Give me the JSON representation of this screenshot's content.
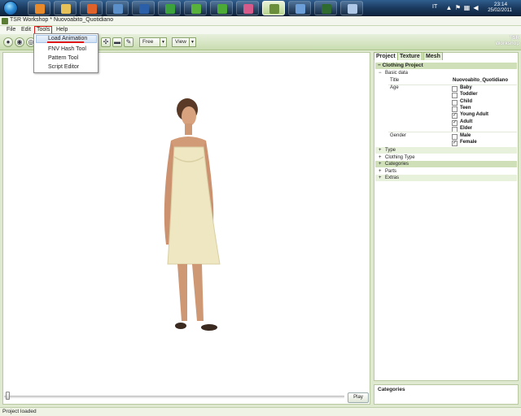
{
  "taskbar": {
    "language": "IT",
    "time": "23:14",
    "date": "25/02/2011",
    "apps": [
      {
        "icon": "media-player-icon",
        "color": "#e8892a"
      },
      {
        "icon": "folder-icon",
        "color": "#e6c15a"
      },
      {
        "icon": "firefox-icon",
        "color": "#e0622a"
      },
      {
        "icon": "globe-icon",
        "color": "#5b8fc9"
      },
      {
        "icon": "photoshop-icon",
        "color": "#2b5fa8"
      },
      {
        "icon": "green-app-icon",
        "color": "#3ca23c"
      },
      {
        "icon": "green-app-icon",
        "color": "#58b13a"
      },
      {
        "icon": "green-app-icon",
        "color": "#4caa36"
      },
      {
        "icon": "pink-app-icon",
        "color": "#d65b8a"
      },
      {
        "icon": "tsr-workshop-icon",
        "color": "#6b8e3d"
      },
      {
        "icon": "globe-icon",
        "color": "#6c9fd8"
      },
      {
        "icon": "w-app-icon",
        "color": "#2f6b2f"
      },
      {
        "icon": "paint-icon",
        "color": "#b0c8e8"
      }
    ]
  },
  "window": {
    "title": "TSR Workshop * Nuovoabito_Quotidiano"
  },
  "menubar": {
    "file": "File",
    "edit": "Edit",
    "tools": "Tools",
    "help": "Help"
  },
  "tools_menu": {
    "items": [
      "Load Animation",
      "FNV Hash Tool",
      "Pattern Tool",
      "Script Editor"
    ]
  },
  "toolbar": {
    "camera_mode": "Free",
    "view_label": "View"
  },
  "logo": {
    "line1": "TSR",
    "line2": "Workshop"
  },
  "viewport": {
    "play_label": "Play"
  },
  "panel": {
    "tabs": [
      "Project",
      "Texture",
      "Mesh"
    ],
    "section": "Clothing Project",
    "basic_data": "Basic data",
    "title_label": "Title",
    "title_value": "Nuovoabito_Quotidiano",
    "age_label": "Age",
    "ages": [
      {
        "label": "Baby",
        "checked": false
      },
      {
        "label": "Toddler",
        "checked": false
      },
      {
        "label": "Child",
        "checked": false
      },
      {
        "label": "Teen",
        "checked": false
      },
      {
        "label": "Young Adult",
        "checked": true
      },
      {
        "label": "Adult",
        "checked": true
      },
      {
        "label": "Elder",
        "checked": false
      }
    ],
    "gender_label": "Gender",
    "genders": [
      {
        "label": "Male",
        "checked": false
      },
      {
        "label": "Female",
        "checked": true
      }
    ],
    "groups": [
      "Type",
      "Clothing Type",
      "Categories",
      "Parts",
      "Extras"
    ],
    "expander_open": "−",
    "expander_closed": "+",
    "categories_title": "Categories"
  },
  "status": {
    "text": "Project loaded"
  }
}
